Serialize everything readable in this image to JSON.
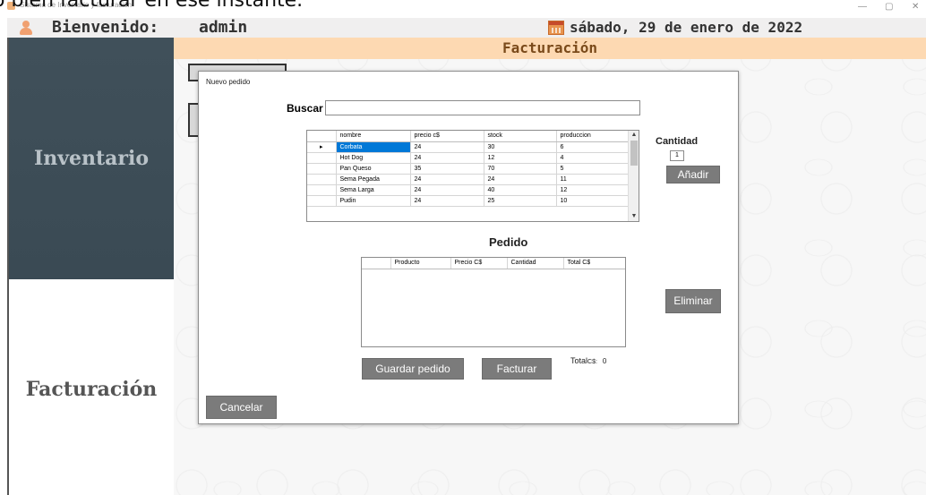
{
  "caption_text": "o bien facturar en ese instante.",
  "window": {
    "title": "Sistema de Inventario y facturación",
    "minimize": "—",
    "maximize": "▢",
    "close": "✕"
  },
  "header": {
    "welcome": "Bienvenido:",
    "username": "admin",
    "date": "sábado, 29 de enero de 2022"
  },
  "sidebar": {
    "inventario": "Inventario",
    "facturacion": "Facturación"
  },
  "content": {
    "title": "Facturación"
  },
  "dialog": {
    "title": "Nuevo pedido",
    "search_label": "Buscar",
    "search_value": "",
    "products_table": {
      "columns": [
        "nombre",
        "precio c$",
        "stock",
        "produccion"
      ],
      "rows": [
        {
          "selected": true,
          "nombre": "Corbata",
          "precio": "24",
          "stock": "30",
          "produccion": "6"
        },
        {
          "selected": false,
          "nombre": "Hot Dog",
          "precio": "24",
          "stock": "12",
          "produccion": "4"
        },
        {
          "selected": false,
          "nombre": "Pan Queso",
          "precio": "35",
          "stock": "70",
          "produccion": "5"
        },
        {
          "selected": false,
          "nombre": "Sema Pegada",
          "precio": "24",
          "stock": "24",
          "produccion": "11"
        },
        {
          "selected": false,
          "nombre": "Sema Larga",
          "precio": "24",
          "stock": "40",
          "produccion": "12"
        },
        {
          "selected": false,
          "nombre": "Pudin",
          "precio": "24",
          "stock": "25",
          "produccion": "10"
        }
      ],
      "current_row_marker": "▸"
    },
    "cantidad_label": "Cantidad",
    "cantidad_value": "1",
    "add_button": "Añadir",
    "pedido_label": "Pedido",
    "order_table": {
      "columns": [
        "Producto",
        "Precio C$",
        "Cantidad",
        "Total C$"
      ],
      "rows": []
    },
    "remove_button": "Eliminar",
    "save_button": "Guardar pedido",
    "invoice_button": "Facturar",
    "total_label": "Total",
    "total_currency": "C$:",
    "total_value": "0",
    "cancel_button": "Cancelar"
  },
  "colors": {
    "sidebar_active": "#3c4c56",
    "title_band": "#fdd9b2",
    "button_gray": "#7b7b7b",
    "selection_blue": "#0078d7"
  }
}
